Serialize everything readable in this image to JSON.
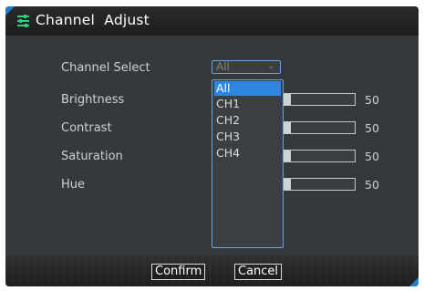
{
  "window": {
    "title": "Channel  Adjust",
    "title_icon": "sliders-icon"
  },
  "labels": {
    "channel_select": "Channel Select",
    "brightness": "Brightness",
    "contrast": "Contrast",
    "saturation": "Saturation",
    "hue": "Hue"
  },
  "channel_select": {
    "value": "All",
    "options": [
      "All",
      "CH1",
      "CH2",
      "CH3",
      "CH4"
    ],
    "highlighted_option": "All"
  },
  "sliders": {
    "brightness": {
      "value": "50",
      "level": 50
    },
    "contrast": {
      "value": "50",
      "level": 50
    },
    "saturation": {
      "value": "50",
      "level": 50
    },
    "hue": {
      "value": "50",
      "level": 50
    }
  },
  "buttons": {
    "confirm": "Confirm",
    "cancel": "Cancel"
  },
  "colors": {
    "accent": "#2f86df",
    "title_icon": "#2fd07a",
    "background": "#36393b"
  }
}
